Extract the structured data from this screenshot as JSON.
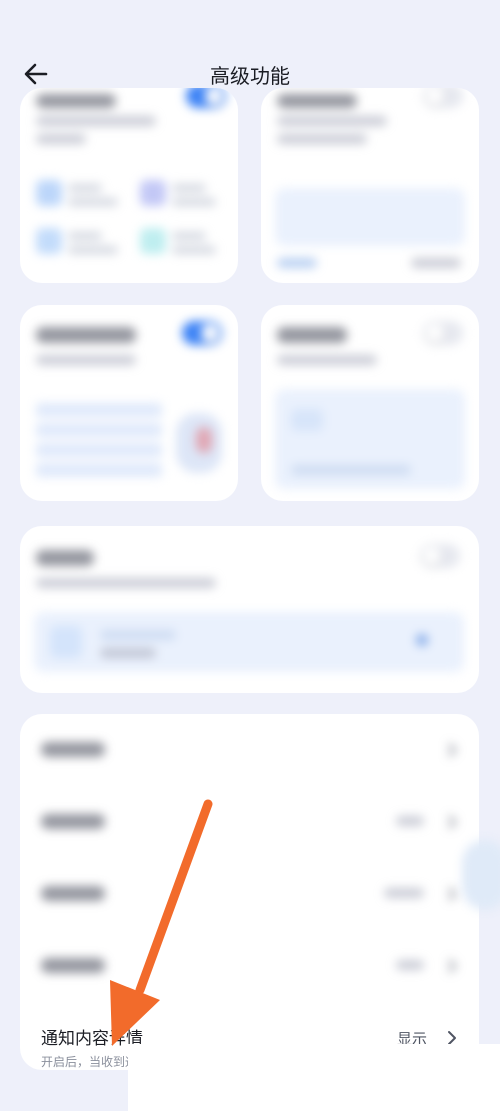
{
  "header": {
    "title": "高级功能"
  },
  "detail_row": {
    "title": "通知内容详情",
    "description": "开启后，当收到通知提醒时，将不会显示具体内容",
    "value": "显示"
  },
  "colors": {
    "accent": "#3b82f6",
    "annotation_arrow": "#f26b2b",
    "background": "#eef0fa",
    "card": "#ffffff"
  },
  "toggles": {
    "smart_assistant_on": true,
    "daily_quote_on": false,
    "status_bar_on": false
  }
}
